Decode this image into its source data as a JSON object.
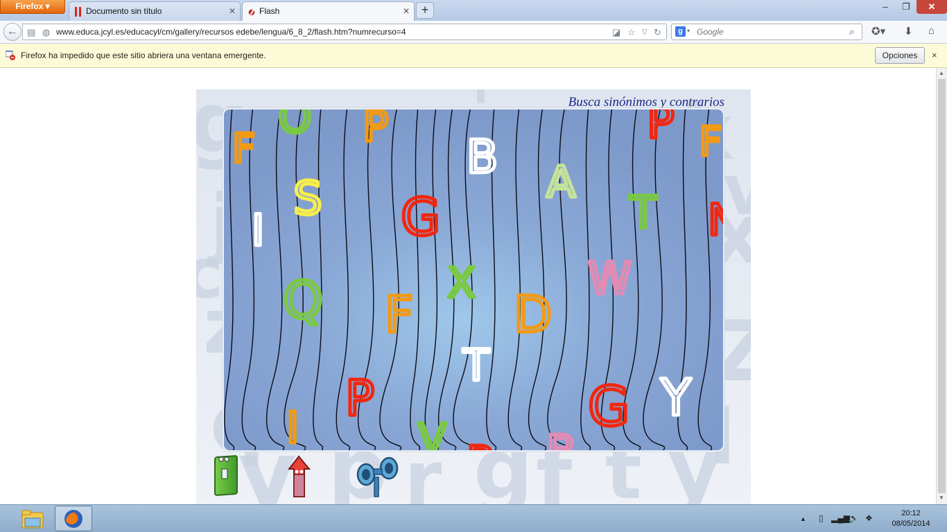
{
  "browser": {
    "menu_label": "Firefox",
    "tabs": [
      {
        "label": "Documento sin título",
        "icon": "pdf-icon"
      },
      {
        "label": "Flash",
        "icon": "flash-icon"
      }
    ],
    "new_tab_label": "+",
    "window_controls": {
      "minimize": "–",
      "maximize": "❐",
      "close": "✕"
    }
  },
  "navbar": {
    "url": "www.educa.jcyl.es/educacyl/cm/gallery/recursos edebe/lengua/6_8_2/flash.htm?numrecurso=4",
    "search_placeholder": "Google",
    "search_engine": "g"
  },
  "notification": {
    "text": "Firefox ha impedido que este sitio abriera una ventana emergente.",
    "button_label": "Opciones",
    "close_label": "×"
  },
  "flash": {
    "title": "Busca sinónimos y contrarios",
    "letters": [
      {
        "ch": "F",
        "color": "#f29a14"
      },
      {
        "ch": "O",
        "color": "#7ac943"
      },
      {
        "ch": "P",
        "color": "#f29a14"
      },
      {
        "ch": "B",
        "color": "#ffffff"
      },
      {
        "ch": "P",
        "color": "#f2270f"
      },
      {
        "ch": "F",
        "color": "#f29a14"
      },
      {
        "ch": "I",
        "color": "#ffffff"
      },
      {
        "ch": "S",
        "color": "#f7ee4c"
      },
      {
        "ch": "G",
        "color": "#f2270f"
      },
      {
        "ch": "A",
        "color": "#c4e39a"
      },
      {
        "ch": "T",
        "color": "#7ac943"
      },
      {
        "ch": "N",
        "color": "#f2270f"
      },
      {
        "ch": "Q",
        "color": "#7ac943"
      },
      {
        "ch": "F",
        "color": "#f29a14"
      },
      {
        "ch": "X",
        "color": "#7ac943"
      },
      {
        "ch": "D",
        "color": "#f29a14"
      },
      {
        "ch": "W",
        "color": "#e28bb4"
      },
      {
        "ch": "T",
        "color": "#ffffff"
      },
      {
        "ch": "Y",
        "color": "#ffffff"
      },
      {
        "ch": "P",
        "color": "#f2270f"
      },
      {
        "ch": "G",
        "color": "#f2270f"
      },
      {
        "ch": "I",
        "color": "#f29a14"
      },
      {
        "ch": "V",
        "color": "#7ac943"
      },
      {
        "ch": "R",
        "color": "#f2270f"
      },
      {
        "ch": "B",
        "color": "#e28bb4"
      }
    ],
    "bg_letters": [
      "g",
      "j",
      "k",
      "x",
      "z",
      "Z",
      "y",
      "p",
      "r",
      "g",
      "f",
      "t",
      "y",
      "q",
      "l",
      "c",
      "v",
      "i"
    ],
    "buttons": {
      "exit": "door-icon",
      "up": "up-arrow-icon",
      "help": "binoculars-icon"
    }
  },
  "taskbar": {
    "apps": [
      "file-explorer-icon",
      "firefox-icon"
    ],
    "clock_time": "20:12",
    "clock_date": "08/05/2014"
  }
}
